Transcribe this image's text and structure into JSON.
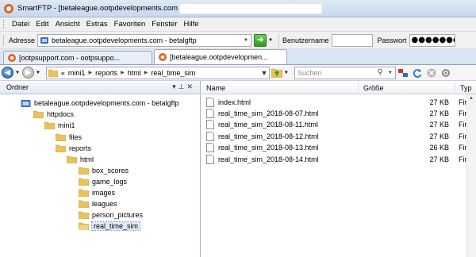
{
  "window": {
    "app_name": "SmartFTP",
    "title": "SmartFTP - [betaleague.ootpdevelopments.com"
  },
  "menu": {
    "items": [
      "Datei",
      "Edit",
      "Ansicht",
      "Extras",
      "Favoriten",
      "Fenster",
      "Hilfe"
    ]
  },
  "address_bar": {
    "label": "Adresse",
    "value": "betaleague.ootpdevelopments.com - betalgftp",
    "username_label": "Benutzername",
    "username_value": "",
    "password_label": "Passwort",
    "password_value": "●●●●●●●●●●●"
  },
  "tabs": [
    {
      "label": "[ootpsupport.com - ootpsuppo...",
      "active": false
    },
    {
      "label": "[betaleague.ootpdevelopmen...",
      "active": true
    }
  ],
  "breadcrumb": {
    "prefix": "«",
    "parts": [
      "mini1",
      "reports",
      "html",
      "real_time_sim"
    ]
  },
  "search": {
    "placeholder": "Suchen"
  },
  "folder_pane": {
    "title": "Ordner",
    "tree": [
      {
        "label": "betaleague.ootpdevelopments.com - betalgftp",
        "level": 0,
        "type": "server"
      },
      {
        "label": "httpdocs",
        "level": 1,
        "type": "folder"
      },
      {
        "label": "mini1",
        "level": 2,
        "type": "folder"
      },
      {
        "label": "files",
        "level": 3,
        "type": "folder"
      },
      {
        "label": "reports",
        "level": 3,
        "type": "folder"
      },
      {
        "label": "html",
        "level": 4,
        "type": "folder"
      },
      {
        "label": "box_scores",
        "level": 5,
        "type": "folder"
      },
      {
        "label": "game_logs",
        "level": 5,
        "type": "folder"
      },
      {
        "label": "images",
        "level": 5,
        "type": "folder"
      },
      {
        "label": "leagues",
        "level": 5,
        "type": "folder"
      },
      {
        "label": "person_pictures",
        "level": 5,
        "type": "folder"
      },
      {
        "label": "real_time_sim",
        "level": 5,
        "type": "folder",
        "selected": true
      }
    ]
  },
  "file_list": {
    "columns": [
      "Name",
      "Größe",
      "Typ"
    ],
    "rows": [
      {
        "name": "index.html",
        "size": "27 KB",
        "type": "Firefox"
      },
      {
        "name": "real_time_sim_2018-08-07.html",
        "size": "27 KB",
        "type": "Firefox"
      },
      {
        "name": "real_time_sim_2018-08-11.html",
        "size": "27 KB",
        "type": "Firefox"
      },
      {
        "name": "real_time_sim_2018-08-12.html",
        "size": "27 KB",
        "type": "Firefox"
      },
      {
        "name": "real_time_sim_2018-08-13.html",
        "size": "26 KB",
        "type": "Firefox"
      },
      {
        "name": "real_time_sim_2018-08-14.html",
        "size": "27 KB",
        "type": "Firefox"
      }
    ]
  },
  "colors": {
    "folder": "#e8c25a",
    "folder_dark": "#c89a2c",
    "accent": "#2f9a23",
    "selection": "#dfe9f7"
  }
}
